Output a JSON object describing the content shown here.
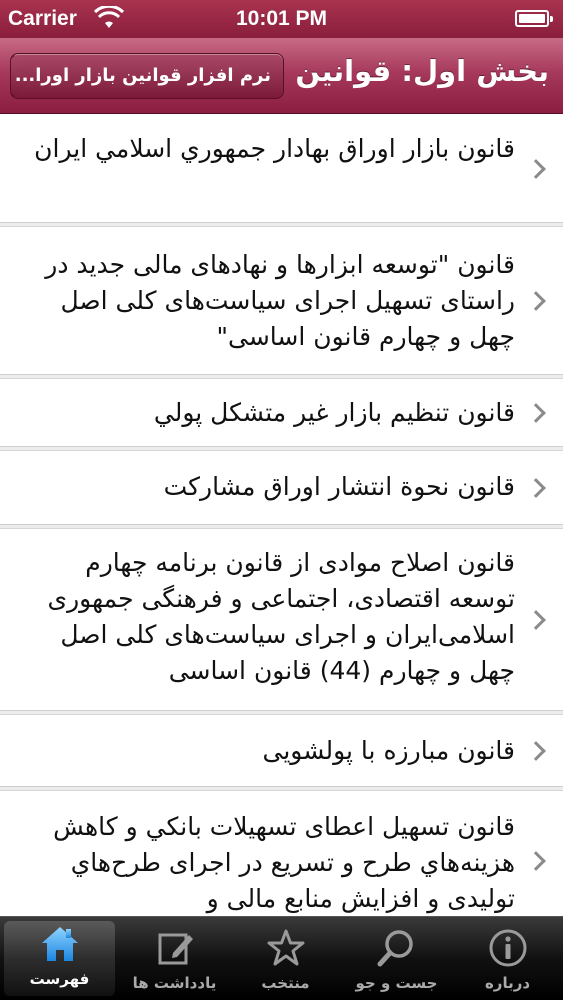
{
  "status_bar": {
    "carrier": "Carrier",
    "time": "10:01 PM"
  },
  "nav": {
    "title": "بخش اول: قوانين",
    "back_label": "نرم افزار قوانين بازار اورا..."
  },
  "list": {
    "items": [
      {
        "label": "قانون بازار اوراق بهادار جمهوري اسلامي ايران"
      },
      {
        "label": "قانون \"توسعه ابزارها و نهادهای مالی جدید در راستای تسهیل اجرای سیاست‌های کلی اصل چهل و چهارم قانون اساسی\""
      },
      {
        "label": "قانون تنظيم بازار غير متشكل پولي"
      },
      {
        "label": "قانون نحوة انتشار اوراق مشاركت"
      },
      {
        "label": "قانون اصلاح موادی از قانون برنامه چهارم توسعه اقتصادی، اجتماعی و فرهنگی جمهوری اسلامی‌ایران و اجرای سیاست‌های کلی اصل چهل و چهارم (44) قانون اساسی"
      },
      {
        "label": "قانون مبارزه با پولشويی"
      },
      {
        "label": "قانون تسهيل اعطای تسهيلات بانكي و كاهش هزينه‌هاي طرح و تسريع در اجرای طرح‌هاي توليدی و افزايش منابع مالی و"
      }
    ]
  },
  "tabs": [
    {
      "label": "فهرست",
      "icon": "home-icon",
      "active": true
    },
    {
      "label": "یادداشت ها",
      "icon": "notes-icon",
      "active": false
    },
    {
      "label": "منتخب",
      "icon": "star-icon",
      "active": false
    },
    {
      "label": "جست و جو",
      "icon": "search-icon",
      "active": false
    },
    {
      "label": "درباره",
      "icon": "info-icon",
      "active": false
    }
  ],
  "colors": {
    "brand": "#9b2a4c",
    "active_tab_icon": "#4fb4ff",
    "inactive_tab_icon": "#9a9a9a"
  }
}
